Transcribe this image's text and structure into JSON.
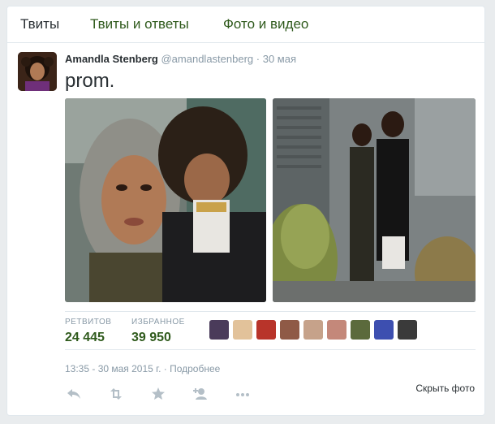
{
  "tabs": [
    {
      "label": "Твиты"
    },
    {
      "label": "Твиты и ответы"
    },
    {
      "label": "Фото и видео"
    }
  ],
  "tweet": {
    "author_name": "Amandla Stenberg",
    "handle": "@amandlastenberg",
    "separator": "·",
    "date": "30 мая",
    "text": "prom."
  },
  "stats": {
    "retweets_label": "РЕТВИТОВ",
    "retweets_value": "24 445",
    "favorites_label": "ИЗБРАННОЕ",
    "favorites_value": "39 950"
  },
  "meta": {
    "timestamp": "13:35 - 30 мая 2015 г.",
    "separator": "·",
    "details_link": "Подробнее"
  },
  "hide_photo_label": "Скрыть фото",
  "actions": [
    {
      "name": "reply-icon"
    },
    {
      "name": "retweet-icon"
    },
    {
      "name": "favorite-icon"
    },
    {
      "name": "follow-icon"
    },
    {
      "name": "more-icon"
    }
  ],
  "colors": {
    "accent": "#2f5a1c",
    "muted": "#8899a6",
    "border": "#e1e8ed"
  }
}
